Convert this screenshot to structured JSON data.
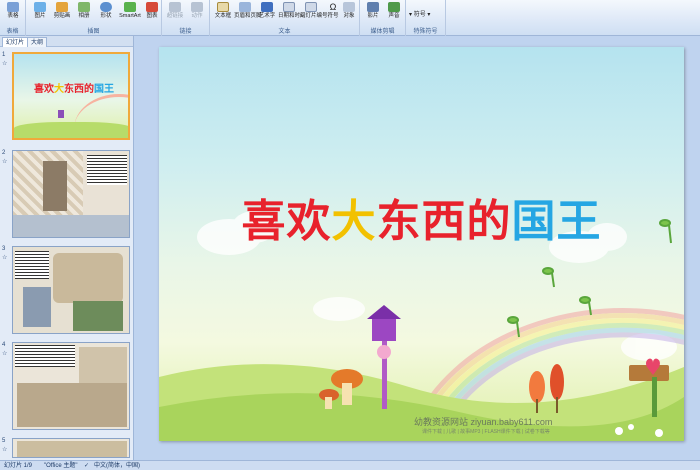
{
  "ribbon": {
    "groups": [
      {
        "name": "表格",
        "buttons": [
          "表格"
        ]
      },
      {
        "name": "插图",
        "buttons": [
          "图片",
          "剪贴画",
          "相册",
          "形状",
          "SmartArt",
          "图表"
        ]
      },
      {
        "name": "链接",
        "buttons": [
          "超链接",
          "动作"
        ]
      },
      {
        "name": "文本",
        "buttons": [
          "文本框",
          "页眉和页脚",
          "艺术字",
          "日期和时间",
          "幻灯片编号",
          "符号",
          "对象"
        ]
      },
      {
        "name": "媒体剪辑",
        "buttons": [
          "影片",
          "声音"
        ]
      },
      {
        "name": "特殊符号",
        "buttons": [
          "符号"
        ]
      }
    ]
  },
  "pane": {
    "tabs": [
      "幻灯片",
      "大纲"
    ],
    "slides": [
      {
        "num": "1",
        "title": "喜欢大东西的国王"
      },
      {
        "num": "2"
      },
      {
        "num": "3"
      },
      {
        "num": "4"
      },
      {
        "num": "5"
      }
    ]
  },
  "slide": {
    "title_parts": [
      {
        "text": "喜欢",
        "color": "#e8222c"
      },
      {
        "text": "大",
        "color": "#f2c100"
      },
      {
        "text": "东西的",
        "color": "#e8222c"
      },
      {
        "text": "国王",
        "color": "#25a6e3"
      }
    ],
    "site": "幼教资源网站  ziyuan.baby611.com",
    "site_small": "课件下载 | 儿歌 | 故事MP3 | FLASH课件下载 | 试卷下载等"
  },
  "status": {
    "slide_info": "幻灯片 1/9",
    "theme": "\"Office 主题\"",
    "language": "中文(简体，中国)"
  }
}
